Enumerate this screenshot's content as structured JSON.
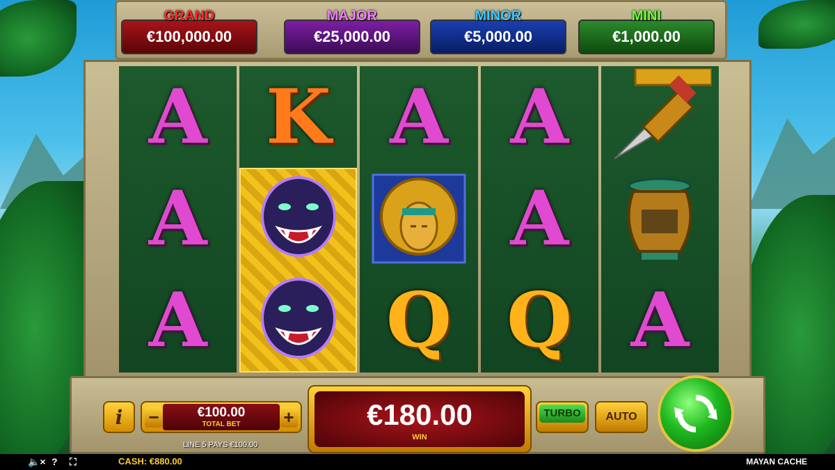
{
  "jackpots": {
    "grand": {
      "name": "GRAND",
      "value": "€100,000.00"
    },
    "major": {
      "name": "MAJOR",
      "value": "€25,000.00"
    },
    "minor": {
      "name": "MINOR",
      "value": "€5,000.00"
    },
    "mini": {
      "name": "MINI",
      "value": "€1,000.00"
    }
  },
  "reels": [
    {
      "symbols": [
        "A",
        "A",
        "A"
      ]
    },
    {
      "symbols": [
        "K",
        "panther",
        "panther"
      ]
    },
    {
      "symbols": [
        "A",
        "mayan-mask",
        "Q"
      ]
    },
    {
      "symbols": [
        "A",
        "A",
        "Q"
      ]
    },
    {
      "symbols": [
        "dagger",
        "urn",
        "A"
      ]
    }
  ],
  "console": {
    "info_label": "i",
    "minus_label": "−",
    "plus_label": "+",
    "bet_value": "€100.00",
    "bet_label": "TOTAL BET",
    "line_pays": "LINE 5 PAYS €100.00",
    "win_value": "€180.00",
    "win_label": "WIN",
    "turbo_label": "TURBO",
    "auto_label": "AUTO"
  },
  "status": {
    "cash_label": "CASH:",
    "cash_value": "€880.00",
    "game_title": "MAYAN CACHE",
    "icons": [
      "mute-icon",
      "help-icon",
      "fullscreen-icon"
    ]
  },
  "colors": {
    "grand": "#ff2a2a",
    "major": "#f07cff",
    "minor": "#39c6ff",
    "mini": "#6bff3a",
    "reel_bg": "#1d5a2c",
    "frame": "#c9bd94",
    "gold": "#ffd23a"
  }
}
